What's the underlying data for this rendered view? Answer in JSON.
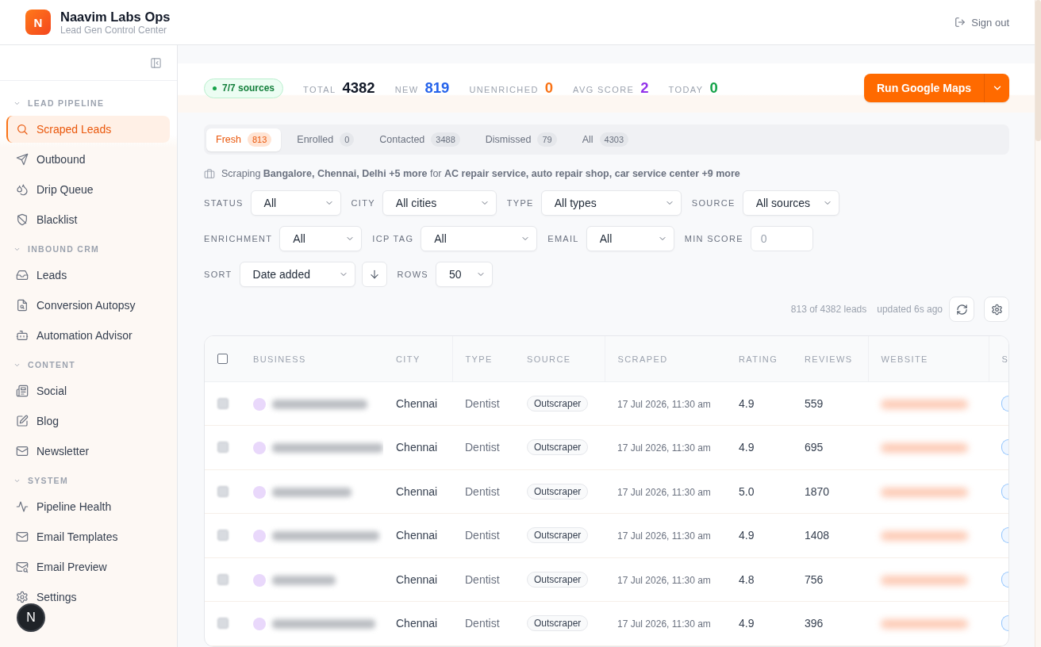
{
  "app": {
    "logo_letter": "N",
    "title": "Naavim Labs Ops",
    "subtitle": "Lead Gen Control Center"
  },
  "header": {
    "sign_out": "Sign out"
  },
  "sidebar": {
    "sections": [
      {
        "title": "LEAD PIPELINE",
        "expanded": true,
        "items": [
          {
            "label": "Scraped Leads",
            "selected": true
          },
          {
            "label": "Outbound",
            "selected": false
          },
          {
            "label": "Drip Queue",
            "selected": false
          },
          {
            "label": "Blacklist",
            "selected": false
          }
        ]
      },
      {
        "title": "INBOUND CRM",
        "expanded": true,
        "items": [
          {
            "label": "Leads",
            "selected": false
          },
          {
            "label": "Conversion Autopsy",
            "selected": false
          },
          {
            "label": "Automation Advisor",
            "selected": false
          }
        ]
      },
      {
        "title": "CONTENT",
        "expanded": true,
        "items": [
          {
            "label": "Social",
            "selected": false
          },
          {
            "label": "Blog",
            "selected": false
          },
          {
            "label": "Newsletter",
            "selected": false
          }
        ]
      },
      {
        "title": "SYSTEM",
        "expanded": true,
        "items": [
          {
            "label": "Pipeline Health",
            "selected": false
          },
          {
            "label": "Email Templates",
            "selected": false
          },
          {
            "label": "Email Preview",
            "selected": false
          },
          {
            "label": "Settings",
            "selected": false
          }
        ]
      }
    ]
  },
  "stats": {
    "sources": "7/7 sources",
    "items": [
      {
        "label": "TOTAL",
        "value": "4382",
        "color": "#111827"
      },
      {
        "label": "NEW",
        "value": "819",
        "color": "#2563eb"
      },
      {
        "label": "UNENRICHED",
        "value": "0",
        "color": "#f97316"
      },
      {
        "label": "AVG SCORE",
        "value": "2",
        "color": "#9333ea"
      },
      {
        "label": "TODAY",
        "value": "0",
        "color": "#16a34a"
      }
    ]
  },
  "primary_action": {
    "label": "Run Google Maps"
  },
  "tabs": [
    {
      "label": "Fresh",
      "count": "813",
      "selected": true
    },
    {
      "label": "Enrolled",
      "count": "0",
      "selected": false
    },
    {
      "label": "Contacted",
      "count": "3488",
      "selected": false
    },
    {
      "label": "Dismissed",
      "count": "79",
      "selected": false
    },
    {
      "label": "All",
      "count": "4303",
      "selected": false
    }
  ],
  "scraping_note": "Scraping **Bangalore, Chennai, Delhi +5 more** for **AC repair service, auto repair shop, car service center +9 more**",
  "filters": [
    [
      {
        "kind": "select",
        "label": "STATUS",
        "value": "All"
      },
      {
        "kind": "select",
        "label": "CITY",
        "value": "All cities"
      },
      {
        "kind": "select",
        "label": "TYPE",
        "value": "All types"
      },
      {
        "kind": "select",
        "label": "SOURCE",
        "value": "All sources"
      }
    ],
    [
      {
        "kind": "select",
        "label": "ENRICHMENT",
        "value": "All"
      },
      {
        "kind": "select",
        "label": "ICP TAG",
        "value": "All"
      },
      {
        "kind": "select",
        "label": "EMAIL",
        "value": "All"
      },
      {
        "kind": "number",
        "label": "MIN SCORE",
        "placeholder": "0"
      }
    ],
    [
      {
        "kind": "select",
        "label": "SORT",
        "value": "Date added"
      },
      {
        "kind": "direction",
        "descending": true
      },
      {
        "kind": "select",
        "label": "ROWS",
        "value": "50"
      }
    ]
  ],
  "results": {
    "count": "813 of 4382 leads",
    "updated": "updated 6s ago"
  },
  "table": {
    "select_all_checked": false,
    "columns": [
      "BUSINESS",
      "CITY",
      "TYPE",
      "SOURCE",
      "SCRAPED",
      "RATING",
      "REVIEWS",
      "WEBSITE",
      "S"
    ],
    "rows": [
      {
        "checked": false,
        "city": "Chennai",
        "type": "Dentist",
        "source": "Outscraper",
        "scraped": "17 Jul 2026, 11:30 am",
        "rating": "4.9",
        "reviews": "559"
      },
      {
        "checked": false,
        "city": "Chennai",
        "type": "Dentist",
        "source": "Outscraper",
        "scraped": "17 Jul 2026, 11:30 am",
        "rating": "4.9",
        "reviews": "695"
      },
      {
        "checked": false,
        "city": "Chennai",
        "type": "Dentist",
        "source": "Outscraper",
        "scraped": "17 Jul 2026, 11:30 am",
        "rating": "5.0",
        "reviews": "1870"
      },
      {
        "checked": false,
        "city": "Chennai",
        "type": "Dentist",
        "source": "Outscraper",
        "scraped": "17 Jul 2026, 11:30 am",
        "rating": "4.9",
        "reviews": "1408"
      },
      {
        "checked": false,
        "city": "Chennai",
        "type": "Dentist",
        "source": "Outscraper",
        "scraped": "17 Jul 2026, 11:30 am",
        "rating": "4.8",
        "reviews": "756"
      },
      {
        "checked": false,
        "city": "Chennai",
        "type": "Dentist",
        "source": "Outscraper",
        "scraped": "17 Jul 2026, 11:30 am",
        "rating": "4.9",
        "reviews": "396"
      }
    ]
  },
  "dev_badge": {
    "label": "N"
  }
}
